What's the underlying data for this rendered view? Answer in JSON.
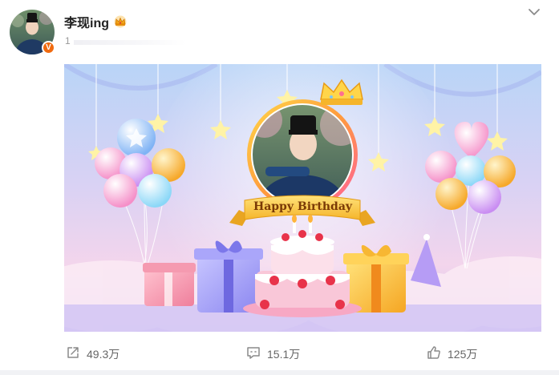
{
  "author": {
    "name": "李现ing",
    "verified_icon": "v-verified-icon",
    "badge_icon": "crown-badge-icon"
  },
  "post": {
    "time": "1"
  },
  "media": {
    "banner_text": "Happy Birthday",
    "alt": "birthday-card-image"
  },
  "actions": {
    "repost": {
      "icon": "share-icon",
      "count": "49.3万"
    },
    "comment": {
      "icon": "comment-icon",
      "count": "15.1万"
    },
    "like": {
      "icon": "thumbs-up-icon",
      "count": "125万"
    }
  },
  "colors": {
    "accent": "#f06a0f",
    "text_muted": "#999999",
    "count_text": "#666666"
  }
}
